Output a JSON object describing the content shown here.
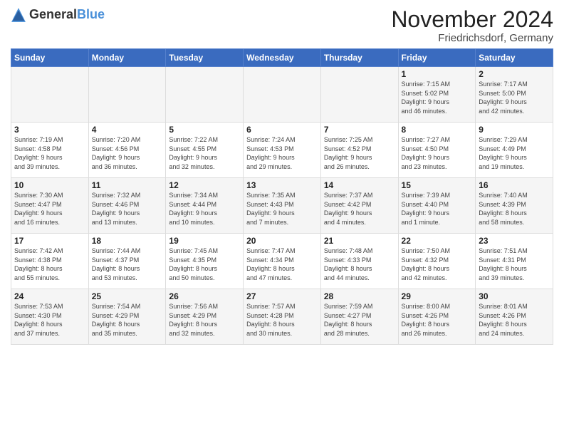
{
  "header": {
    "logo_general": "General",
    "logo_blue": "Blue",
    "month_title": "November 2024",
    "location": "Friedrichsdorf, Germany"
  },
  "days_of_week": [
    "Sunday",
    "Monday",
    "Tuesday",
    "Wednesday",
    "Thursday",
    "Friday",
    "Saturday"
  ],
  "weeks": [
    [
      {
        "day": "",
        "info": ""
      },
      {
        "day": "",
        "info": ""
      },
      {
        "day": "",
        "info": ""
      },
      {
        "day": "",
        "info": ""
      },
      {
        "day": "",
        "info": ""
      },
      {
        "day": "1",
        "info": "Sunrise: 7:15 AM\nSunset: 5:02 PM\nDaylight: 9 hours\nand 46 minutes."
      },
      {
        "day": "2",
        "info": "Sunrise: 7:17 AM\nSunset: 5:00 PM\nDaylight: 9 hours\nand 42 minutes."
      }
    ],
    [
      {
        "day": "3",
        "info": "Sunrise: 7:19 AM\nSunset: 4:58 PM\nDaylight: 9 hours\nand 39 minutes."
      },
      {
        "day": "4",
        "info": "Sunrise: 7:20 AM\nSunset: 4:56 PM\nDaylight: 9 hours\nand 36 minutes."
      },
      {
        "day": "5",
        "info": "Sunrise: 7:22 AM\nSunset: 4:55 PM\nDaylight: 9 hours\nand 32 minutes."
      },
      {
        "day": "6",
        "info": "Sunrise: 7:24 AM\nSunset: 4:53 PM\nDaylight: 9 hours\nand 29 minutes."
      },
      {
        "day": "7",
        "info": "Sunrise: 7:25 AM\nSunset: 4:52 PM\nDaylight: 9 hours\nand 26 minutes."
      },
      {
        "day": "8",
        "info": "Sunrise: 7:27 AM\nSunset: 4:50 PM\nDaylight: 9 hours\nand 23 minutes."
      },
      {
        "day": "9",
        "info": "Sunrise: 7:29 AM\nSunset: 4:49 PM\nDaylight: 9 hours\nand 19 minutes."
      }
    ],
    [
      {
        "day": "10",
        "info": "Sunrise: 7:30 AM\nSunset: 4:47 PM\nDaylight: 9 hours\nand 16 minutes."
      },
      {
        "day": "11",
        "info": "Sunrise: 7:32 AM\nSunset: 4:46 PM\nDaylight: 9 hours\nand 13 minutes."
      },
      {
        "day": "12",
        "info": "Sunrise: 7:34 AM\nSunset: 4:44 PM\nDaylight: 9 hours\nand 10 minutes."
      },
      {
        "day": "13",
        "info": "Sunrise: 7:35 AM\nSunset: 4:43 PM\nDaylight: 9 hours\nand 7 minutes."
      },
      {
        "day": "14",
        "info": "Sunrise: 7:37 AM\nSunset: 4:42 PM\nDaylight: 9 hours\nand 4 minutes."
      },
      {
        "day": "15",
        "info": "Sunrise: 7:39 AM\nSunset: 4:40 PM\nDaylight: 9 hours\nand 1 minute."
      },
      {
        "day": "16",
        "info": "Sunrise: 7:40 AM\nSunset: 4:39 PM\nDaylight: 8 hours\nand 58 minutes."
      }
    ],
    [
      {
        "day": "17",
        "info": "Sunrise: 7:42 AM\nSunset: 4:38 PM\nDaylight: 8 hours\nand 55 minutes."
      },
      {
        "day": "18",
        "info": "Sunrise: 7:44 AM\nSunset: 4:37 PM\nDaylight: 8 hours\nand 53 minutes."
      },
      {
        "day": "19",
        "info": "Sunrise: 7:45 AM\nSunset: 4:35 PM\nDaylight: 8 hours\nand 50 minutes."
      },
      {
        "day": "20",
        "info": "Sunrise: 7:47 AM\nSunset: 4:34 PM\nDaylight: 8 hours\nand 47 minutes."
      },
      {
        "day": "21",
        "info": "Sunrise: 7:48 AM\nSunset: 4:33 PM\nDaylight: 8 hours\nand 44 minutes."
      },
      {
        "day": "22",
        "info": "Sunrise: 7:50 AM\nSunset: 4:32 PM\nDaylight: 8 hours\nand 42 minutes."
      },
      {
        "day": "23",
        "info": "Sunrise: 7:51 AM\nSunset: 4:31 PM\nDaylight: 8 hours\nand 39 minutes."
      }
    ],
    [
      {
        "day": "24",
        "info": "Sunrise: 7:53 AM\nSunset: 4:30 PM\nDaylight: 8 hours\nand 37 minutes."
      },
      {
        "day": "25",
        "info": "Sunrise: 7:54 AM\nSunset: 4:29 PM\nDaylight: 8 hours\nand 35 minutes."
      },
      {
        "day": "26",
        "info": "Sunrise: 7:56 AM\nSunset: 4:29 PM\nDaylight: 8 hours\nand 32 minutes."
      },
      {
        "day": "27",
        "info": "Sunrise: 7:57 AM\nSunset: 4:28 PM\nDaylight: 8 hours\nand 30 minutes."
      },
      {
        "day": "28",
        "info": "Sunrise: 7:59 AM\nSunset: 4:27 PM\nDaylight: 8 hours\nand 28 minutes."
      },
      {
        "day": "29",
        "info": "Sunrise: 8:00 AM\nSunset: 4:26 PM\nDaylight: 8 hours\nand 26 minutes."
      },
      {
        "day": "30",
        "info": "Sunrise: 8:01 AM\nSunset: 4:26 PM\nDaylight: 8 hours\nand 24 minutes."
      }
    ]
  ]
}
